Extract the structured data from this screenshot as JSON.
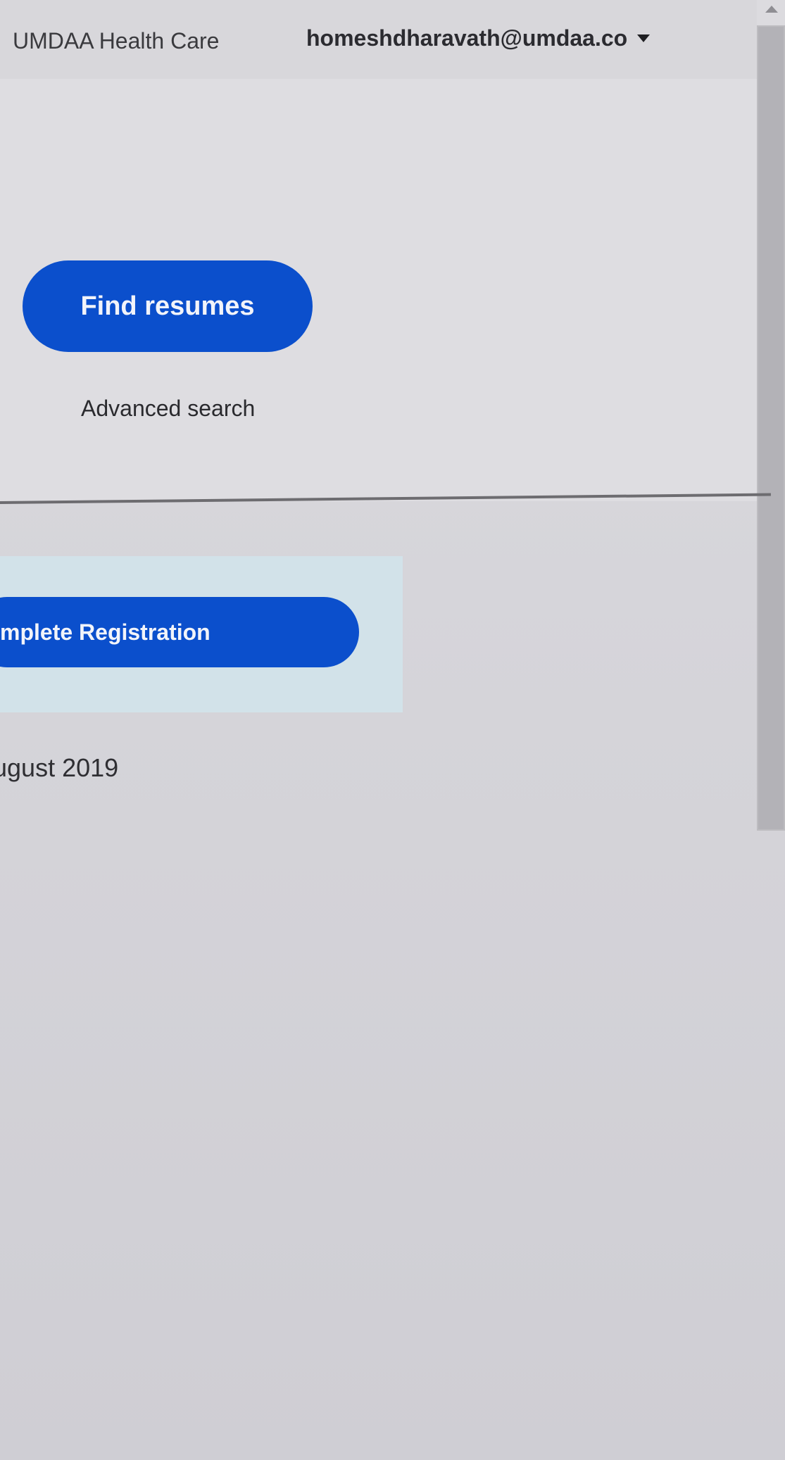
{
  "header": {
    "brand": "UMDAA Health Care",
    "account_email": "homeshdharavath@umdaa.co"
  },
  "search": {
    "find_button_label": "Find resumes",
    "advanced_link_label": "Advanced search"
  },
  "registration": {
    "button_label": "mplete Registration",
    "date_text": "ugust 2019"
  },
  "colors": {
    "primary_button": "#0b4fcc",
    "card_background": "#d2e2e9"
  },
  "icons": {
    "account_menu": "caret-down-icon",
    "scroll_up": "scroll-up-arrow-icon"
  }
}
